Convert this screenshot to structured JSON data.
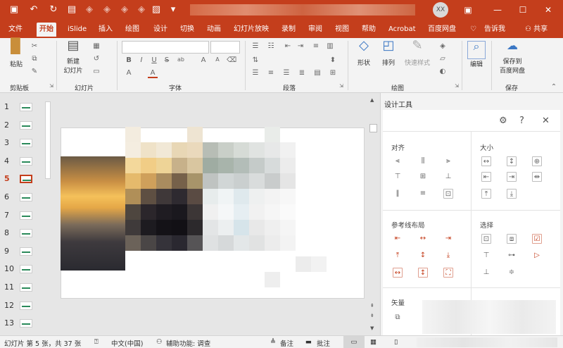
{
  "title_bar": {
    "avatar_initials": "XX",
    "quick_access": [
      "save-icon",
      "undo-icon",
      "redo-icon",
      "present-icon",
      "shape-icon",
      "shape-icon",
      "shape-icon",
      "shape-icon",
      "picture-icon",
      "more-icon"
    ],
    "window_buttons": [
      "ribbon-display-icon",
      "minimize-icon",
      "maximize-icon",
      "close-icon"
    ],
    "accent": "#c43e1c"
  },
  "tabs": [
    "文件",
    "开始",
    "iSlide",
    "插入",
    "绘图",
    "设计",
    "切换",
    "动画",
    "幻灯片放映",
    "录制",
    "审阅",
    "视图",
    "帮助",
    "Acrobat",
    "百度网盘"
  ],
  "active_tab": "开始",
  "tell_me": "告诉我",
  "share": "共享",
  "ribbon": {
    "clipboard": {
      "paste": "粘贴",
      "label": "剪贴板"
    },
    "slides": {
      "new_slide_1": "新建",
      "new_slide_2": "幻灯片",
      "label": "幻灯片"
    },
    "font": {
      "label": "字体",
      "buttons": [
        "B",
        "I",
        "U",
        "S",
        "ab",
        "A",
        "A",
        "A",
        "A"
      ]
    },
    "paragraph": {
      "label": "段落"
    },
    "drawing": {
      "shapes": "形状",
      "arrange": "排列",
      "quick_styles": "快速样式",
      "label": "绘图"
    },
    "editing": {
      "label": "编辑"
    },
    "save": {
      "line1": "保存到",
      "line2": "百度网盘",
      "label": "保存"
    }
  },
  "thumbnails": [
    {
      "num": "1"
    },
    {
      "num": "2"
    },
    {
      "num": "3"
    },
    {
      "num": "4"
    },
    {
      "num": "5"
    },
    {
      "num": "6"
    },
    {
      "num": "7"
    },
    {
      "num": "8"
    },
    {
      "num": "9"
    },
    {
      "num": "10"
    },
    {
      "num": "11"
    },
    {
      "num": "12"
    },
    {
      "num": "13"
    }
  ],
  "active_thumbnail": "5",
  "design_pane": {
    "title": "设计工具",
    "header_icons": [
      "settings-icon",
      "help-icon",
      "close-icon"
    ],
    "sections": {
      "align": "对齐",
      "size": "大小",
      "guide_layout": "参考线布局",
      "select": "选择",
      "vector": "矢量"
    }
  },
  "status_bar": {
    "slide_info": "幻灯片 第 5 张，共 37 张",
    "language": "中文(中国)",
    "accessibility": "辅助功能: 调查",
    "notes": "备注",
    "comments": "批注"
  }
}
